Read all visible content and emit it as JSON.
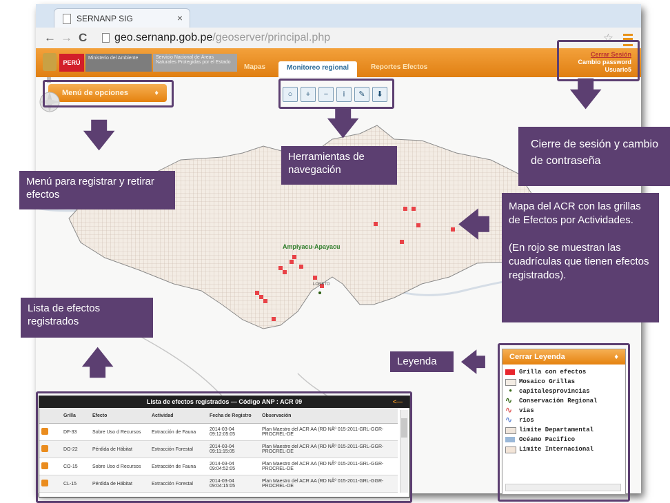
{
  "browser": {
    "tab_title": "SERNANP SIG",
    "tab_close": "×",
    "url_host": "geo.sernanp.gob.pe",
    "url_path": "/geoserver/principal.php",
    "back": "←",
    "forward": "→",
    "reload": "C",
    "star": "☆"
  },
  "header": {
    "logo_peru": "PERÚ",
    "logo_ministry": "Ministerio del Ambiente",
    "logo_sernanp": "Servicio Nacional de Áreas Naturales Protegidas por el Estado",
    "tabs": [
      "Mapas",
      "Monitoreo regional",
      "Reportes Efectos"
    ],
    "session": {
      "logout": "Cerrar Sesión",
      "change_password": "Cambio password",
      "user": "Usuario5"
    }
  },
  "map": {
    "options_button": "Menú de opciones",
    "pin": "♦",
    "tools": [
      "○",
      "+",
      "−",
      "i",
      "✎",
      "⬇"
    ],
    "labels": {
      "acr": "Ampiyacu-Apayacu",
      "city": "LORETO"
    }
  },
  "callouts": {
    "menu": "Menú para registrar y retirar efectos",
    "tools": "Herramientas de navegación",
    "session": "Cierre de sesión y cambio de contraseña",
    "map": "Mapa del ACR con las grillas de Efectos por Actividades.",
    "map_note": "(En rojo se muestran las cuadrículas que tienen efectos registrados).",
    "list": "Lista de efectos registrados",
    "legend": "Leyenda"
  },
  "effects": {
    "title": "Lista de efectos registrados — Código ANP : ACR 09",
    "back": "<—",
    "columns": [
      "",
      "Grilla",
      "Efecto",
      "Actividad",
      "Fecha de Registro",
      "Observación"
    ],
    "rows": [
      [
        "DF-33",
        "Sobre Uso d Recursos",
        "Extracción de Fauna",
        "2014-03-04 09:12:05:05",
        "Plan Maestro del ACR AA (RD NÂº 015-2011-GRL-GGR-PROCREL-DE"
      ],
      [
        "DO-22",
        "Pérdida de Hábitat",
        "Extracción Forestal",
        "2014-03-04 09:11:15:05",
        "Plan Maestro del ACR AA (RD NÂº 015-2011-GRL-GGR-PROCREL-DE"
      ],
      [
        "CO-15",
        "Sobre Uso d Recursos",
        "Extracción de Fauna",
        "2014-03-04 09:04:52:05",
        "Plan Maestro del ACR AA (RD NÂº 015-2011-GRL-GGR-PROCREL-DE"
      ],
      [
        "CL-15",
        "Pérdida de Hábitat",
        "Extracción Forestal",
        "2014-03-04 09:04:15:05",
        "Plan Maestro del ACR AA (RD NÂº 015-2011-GRL-GGR-PROCREL-DE"
      ]
    ]
  },
  "legend": {
    "title": "Cerrar Leyenda",
    "items": [
      {
        "label": "Grilla con efectos",
        "color": "#e8262d"
      },
      {
        "label": "Mosaico Grillas",
        "color": "#f3ece4"
      },
      {
        "label": "capitalesprovincias",
        "color": "#3a6a1a"
      },
      {
        "label": "Conservación Regional",
        "color": "#3a6a1a"
      },
      {
        "label": "vias",
        "color": "#e06060"
      },
      {
        "label": "rios",
        "color": "#6a8cd6"
      },
      {
        "label": "limite Departamental",
        "color": "#f0e6dc"
      },
      {
        "label": "Océano Pacifico",
        "color": "#9ab8d8"
      },
      {
        "label": "Limite Internacional",
        "color": "#f3e5d8"
      }
    ]
  },
  "colors": {
    "accent": "#5c3f71",
    "header": "#e88a1a",
    "grid_red": "#e8262d"
  }
}
